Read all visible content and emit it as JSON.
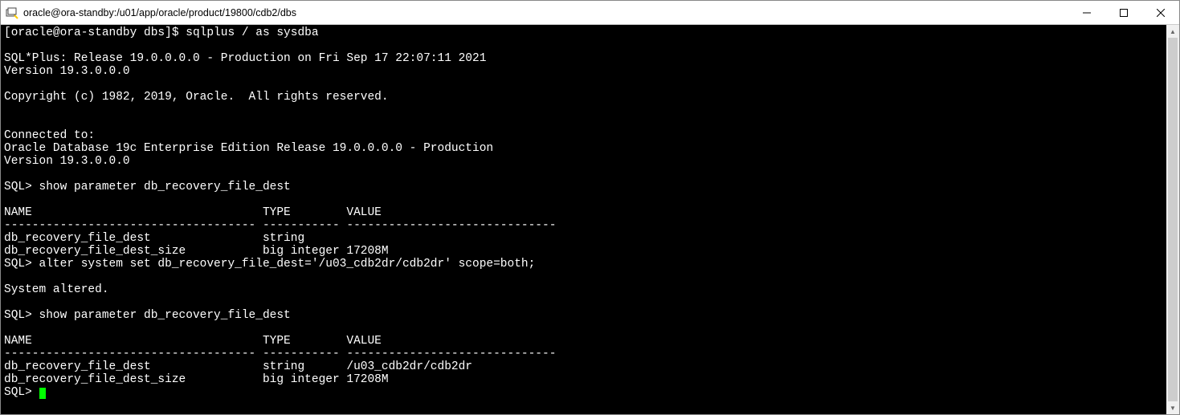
{
  "window": {
    "title": "oracle@ora-standby:/u01/app/oracle/product/19800/cdb2/dbs"
  },
  "terminal": {
    "lines": [
      "[oracle@ora-standby dbs]$ sqlplus / as sysdba",
      "",
      "SQL*Plus: Release 19.0.0.0.0 - Production on Fri Sep 17 22:07:11 2021",
      "Version 19.3.0.0.0",
      "",
      "Copyright (c) 1982, 2019, Oracle.  All rights reserved.",
      "",
      "",
      "Connected to:",
      "Oracle Database 19c Enterprise Edition Release 19.0.0.0.0 - Production",
      "Version 19.3.0.0.0",
      "",
      "SQL> show parameter db_recovery_file_dest",
      "",
      "NAME                                 TYPE        VALUE",
      "------------------------------------ ----------- ------------------------------",
      "db_recovery_file_dest                string",
      "db_recovery_file_dest_size           big integer 17208M",
      "SQL> alter system set db_recovery_file_dest='/u03_cdb2dr/cdb2dr' scope=both;",
      "",
      "System altered.",
      "",
      "SQL> show parameter db_recovery_file_dest",
      "",
      "NAME                                 TYPE        VALUE",
      "------------------------------------ ----------- ------------------------------",
      "db_recovery_file_dest                string      /u03_cdb2dr/cdb2dr",
      "db_recovery_file_dest_size           big integer 17208M",
      "SQL> "
    ]
  }
}
